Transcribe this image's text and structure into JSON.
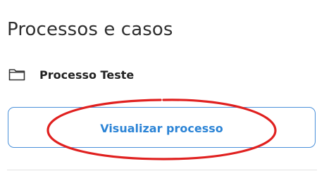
{
  "section": {
    "title": "Processos e casos"
  },
  "item": {
    "icon": "folder-icon",
    "label": "Processo Teste"
  },
  "button": {
    "label": "Visualizar processo"
  },
  "colors": {
    "accent": "#2c84d6",
    "button_border": "#4a90d9",
    "annotation": "#e0201f"
  }
}
